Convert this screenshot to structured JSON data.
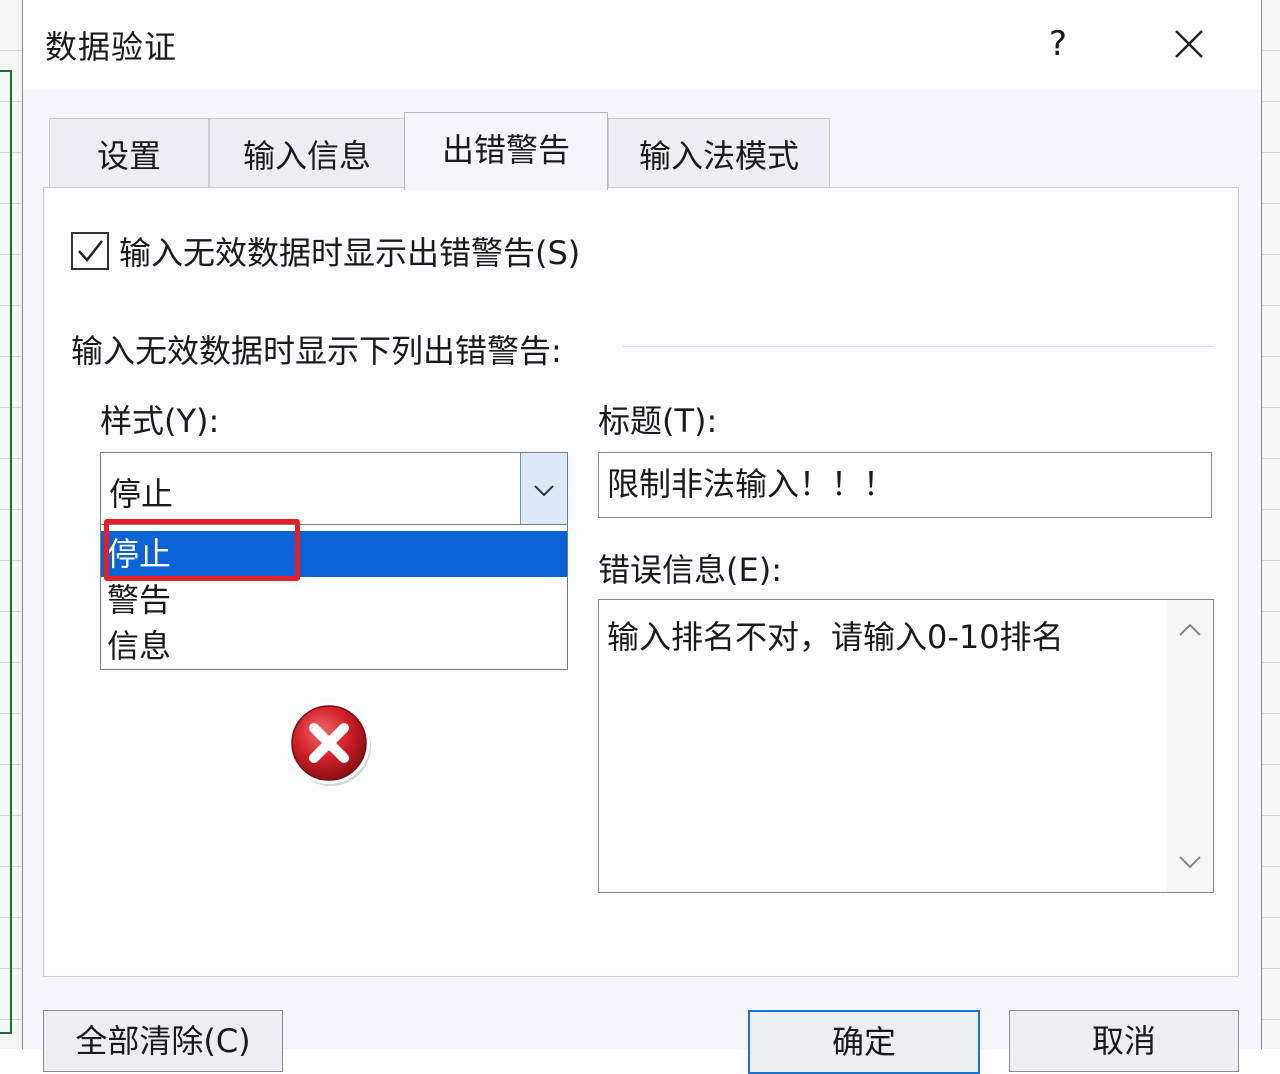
{
  "dialog": {
    "title": "数据验证",
    "help": "?"
  },
  "tabs": [
    {
      "label": "设置"
    },
    {
      "label": "输入信息"
    },
    {
      "label": "出错警告"
    },
    {
      "label": "输入法模式"
    }
  ],
  "error_alert": {
    "show_checkbox_label": "输入无效数据时显示出错警告(S)",
    "show_checkbox_checked": true,
    "group_label": "输入无效数据时显示下列出错警告:",
    "style_label": "样式(Y):",
    "style_value": "停止",
    "style_options": [
      "停止",
      "警告",
      "信息"
    ],
    "title_label": "标题(T):",
    "title_value": "限制非法输入！！！",
    "message_label": "错误信息(E):",
    "message_value": "输入排名不对，请输入0-10排名"
  },
  "buttons": {
    "clear_all": "全部清除(C)",
    "ok": "确定",
    "cancel": "取消"
  },
  "colors": {
    "selection_blue": "#0a63d6",
    "highlight_red": "#e3202a",
    "stop_icon_red": "#d3202a"
  }
}
